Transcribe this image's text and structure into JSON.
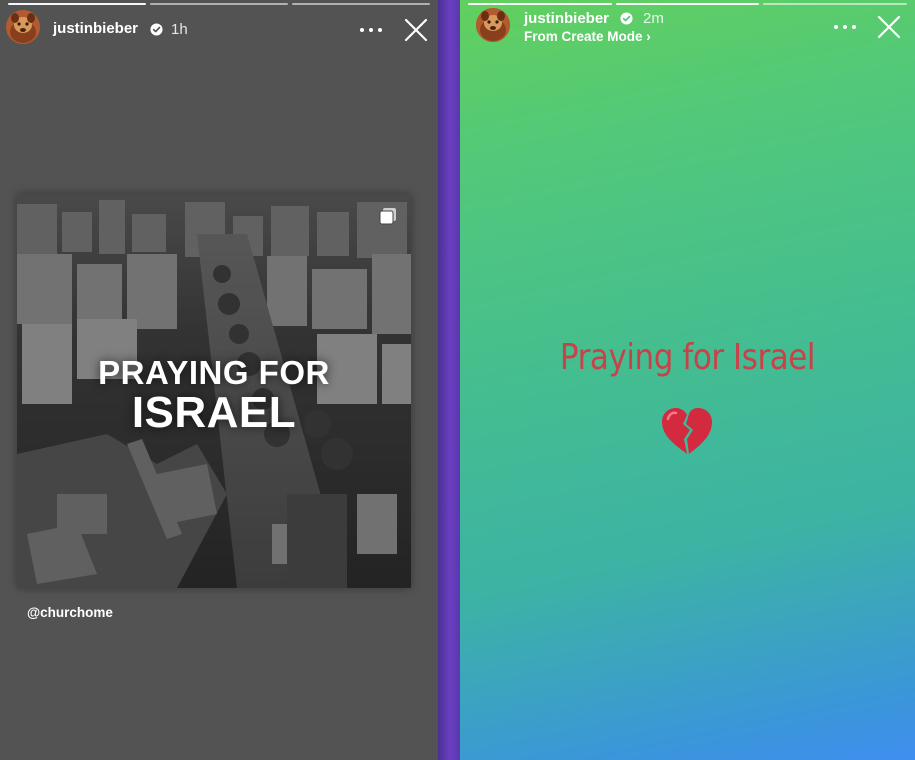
{
  "left_story": {
    "username": "justinbieber",
    "time": "1h",
    "progress": {
      "total_segments": 3,
      "current_segment": 1
    },
    "post": {
      "headline_line1": "PRAYING FOR",
      "headline_line2": "ISRAEL"
    },
    "mention": "@churchome"
  },
  "right_story": {
    "username": "justinbieber",
    "time": "2m",
    "subtitle": "From Create Mode ›",
    "progress": {
      "total_segments": 3,
      "current_segment": 2
    },
    "text": "Praying for Israel",
    "emoji": "broken-heart",
    "background_gradient": [
      "#62d05e",
      "#3cb3a4",
      "#3e8ff0"
    ],
    "text_color": "#c8424a"
  },
  "colors": {
    "left_background": "#535353",
    "divider": "#6a3fc0"
  },
  "icons": {
    "verified": "verified-badge-icon",
    "more": "more-options-icon",
    "close": "close-icon",
    "multi_image": "multiple-images-icon"
  }
}
